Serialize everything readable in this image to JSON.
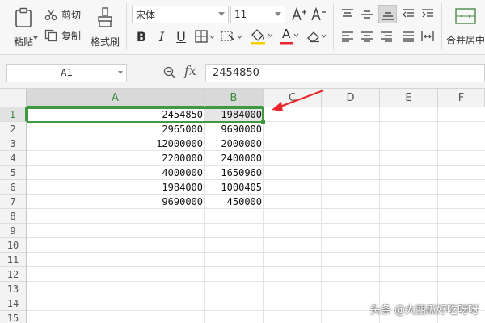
{
  "ribbon": {
    "paste_label": "粘贴",
    "cut_label": "剪切",
    "copy_label": "复制",
    "format_painter_label": "格式刷",
    "font_name": "宋体",
    "font_size": "11",
    "bold": "B",
    "italic": "I",
    "underline": "U",
    "font_color_letter": "A",
    "grow_font": "A+",
    "shrink_font": "A-",
    "merge_center_label": "合并居中"
  },
  "formula_bar": {
    "name_box": "A1",
    "fx_label": "fx",
    "value": "2454850"
  },
  "sheet": {
    "columns": [
      "A",
      "B",
      "C",
      "D",
      "E",
      "F"
    ],
    "rows": [
      "1",
      "2",
      "3",
      "4",
      "5",
      "6",
      "7",
      "8",
      "9",
      "10",
      "11",
      "12",
      "13",
      "14",
      "15"
    ],
    "data": [
      [
        "2454850",
        "1984000"
      ],
      [
        "2965000",
        "9690000"
      ],
      [
        "12000000",
        "2000000"
      ],
      [
        "2200000",
        "2400000"
      ],
      [
        "4000000",
        "1650960"
      ],
      [
        "1984000",
        "1000405"
      ],
      [
        "9690000",
        "450000"
      ]
    ]
  },
  "watermark": "头条 @大西瓜好吃呀呀",
  "colors": {
    "selection": "#3f9a3f",
    "arrow": "#e8262c"
  }
}
